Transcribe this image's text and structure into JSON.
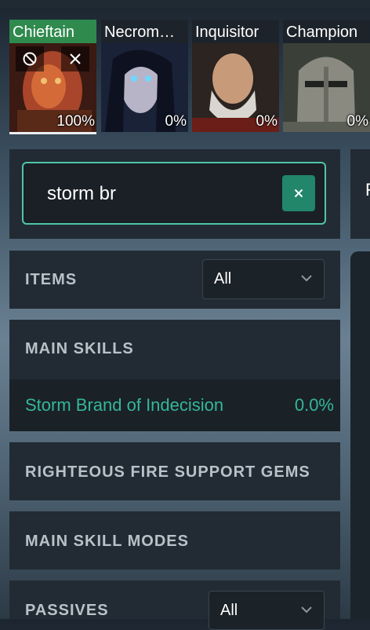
{
  "classes": [
    {
      "name": "Chieftain",
      "percent": "100%",
      "active": true
    },
    {
      "name": "Necrom…",
      "percent": "0%",
      "active": false
    },
    {
      "name": "Inquisitor",
      "percent": "0%",
      "active": false
    },
    {
      "name": "Champion",
      "percent": "0%",
      "active": false
    }
  ],
  "card_controls": {
    "exclude_icon": "ban-icon",
    "remove_icon": "close-icon"
  },
  "search": {
    "value": "storm br",
    "clear_icon": "close-icon"
  },
  "right_panel_partial_label": "F",
  "sections": {
    "items": {
      "title": "ITEMS",
      "filter_value": "All"
    },
    "main_skills": {
      "title": "MAIN SKILLS",
      "rows": [
        {
          "name": "Storm Brand of Indecision",
          "value": "0.0%"
        }
      ]
    },
    "support_gems": {
      "title": "RIGHTEOUS FIRE SUPPORT GEMS"
    },
    "skill_modes": {
      "title": "MAIN SKILL MODES"
    },
    "passives": {
      "title": "PASSIVES",
      "filter_value": "All"
    }
  },
  "colors": {
    "accent": "#4fc6a7",
    "active_class": "#2f8a4e",
    "skill_text": "#34b79a",
    "clear_button": "#22866a"
  }
}
